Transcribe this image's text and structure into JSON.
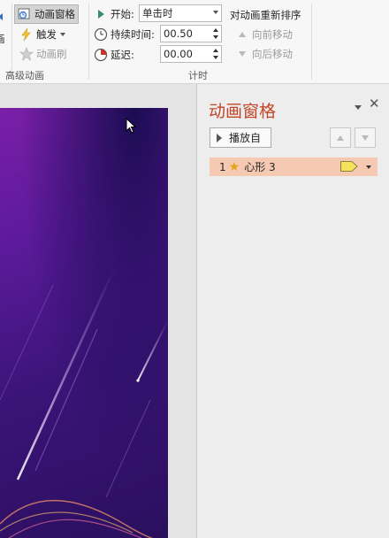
{
  "ribbon": {
    "left_cut_label": "画",
    "advanced": {
      "pane_btn": "动画窗格",
      "trigger_btn": "触发",
      "painter_btn": "动画刷",
      "group_label": "高级动画"
    },
    "timing": {
      "start_label": "开始:",
      "start_value": "单击时",
      "duration_label": "持续时间:",
      "duration_value": "00.50",
      "delay_label": "延迟:",
      "delay_value": "00.00",
      "reorder_title": "对动画重新排序",
      "move_earlier": "向前移动",
      "move_later": "向后移动",
      "group_label": "计时"
    }
  },
  "pane": {
    "title": "动画窗格",
    "play_label": "播放自",
    "items": [
      {
        "number": "1",
        "name": "心形 3"
      }
    ]
  },
  "colors": {
    "pane_title": "#c4452a",
    "selected_row": "#f6c9b3",
    "star": "#e3a21a",
    "timing_bar": "#f5e15a"
  }
}
